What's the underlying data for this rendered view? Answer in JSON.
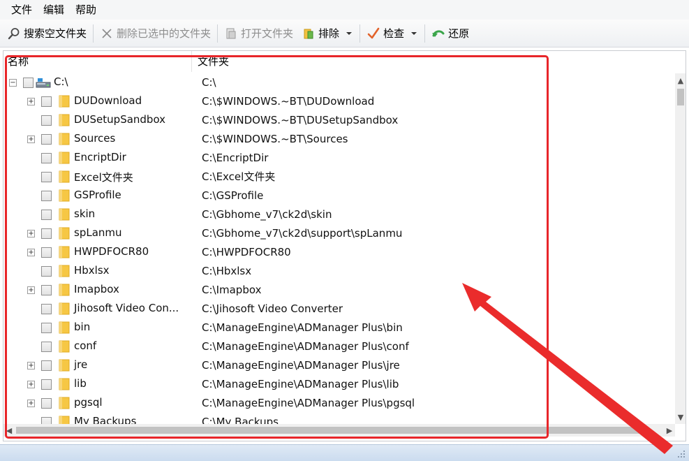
{
  "menu": [
    "文件",
    "编辑",
    "帮助"
  ],
  "toolbar": {
    "search_label": "搜索空文件夹",
    "delete_label": "删除已选中的文件夹",
    "open_label": "打开文件夹",
    "exclude_label": "排除",
    "check_label": "检查",
    "restore_label": "还原"
  },
  "columns": {
    "name": "名称",
    "folder": "文件夹"
  },
  "rows": [
    {
      "level": 0,
      "expander": "minus",
      "icon": "drive-icon",
      "name": "C:\\",
      "folder": "C:\\"
    },
    {
      "level": 1,
      "expander": "plus",
      "icon": "folder-icon",
      "name": "DUDownload",
      "folder": "C:\\$WINDOWS.~BT\\DUDownload"
    },
    {
      "level": 1,
      "expander": "",
      "icon": "folder-icon",
      "name": "DUSetupSandbox",
      "folder": "C:\\$WINDOWS.~BT\\DUSetupSandbox"
    },
    {
      "level": 1,
      "expander": "plus",
      "icon": "folder-icon",
      "name": "Sources",
      "folder": "C:\\$WINDOWS.~BT\\Sources"
    },
    {
      "level": 1,
      "expander": "",
      "icon": "folder-icon",
      "name": "EncriptDir",
      "folder": "C:\\EncriptDir"
    },
    {
      "level": 1,
      "expander": "",
      "icon": "folder-icon",
      "name": "Excel文件夹",
      "folder": "C:\\Excel文件夹"
    },
    {
      "level": 1,
      "expander": "",
      "icon": "folder-icon",
      "name": "GSProfile",
      "folder": "C:\\GSProfile"
    },
    {
      "level": 1,
      "expander": "",
      "icon": "folder-icon",
      "name": "skin",
      "folder": "C:\\Gbhome_v7\\ck2d\\skin"
    },
    {
      "level": 1,
      "expander": "plus",
      "icon": "folder-icon",
      "name": "spLanmu",
      "folder": "C:\\Gbhome_v7\\ck2d\\support\\spLanmu"
    },
    {
      "level": 1,
      "expander": "plus",
      "icon": "folder-icon",
      "name": "HWPDFOCR80",
      "folder": "C:\\HWPDFOCR80"
    },
    {
      "level": 1,
      "expander": "",
      "icon": "folder-icon",
      "name": "Hbxlsx",
      "folder": "C:\\Hbxlsx"
    },
    {
      "level": 1,
      "expander": "plus",
      "icon": "folder-icon",
      "name": "Imapbox",
      "folder": "C:\\Imapbox"
    },
    {
      "level": 1,
      "expander": "",
      "icon": "folder-icon",
      "name": "Jihosoft Video Con...",
      "folder": "C:\\Jihosoft Video Converter"
    },
    {
      "level": 1,
      "expander": "",
      "icon": "folder-icon",
      "name": "bin",
      "folder": "C:\\ManageEngine\\ADManager Plus\\bin"
    },
    {
      "level": 1,
      "expander": "",
      "icon": "folder-icon",
      "name": "conf",
      "folder": "C:\\ManageEngine\\ADManager Plus\\conf"
    },
    {
      "level": 1,
      "expander": "plus",
      "icon": "folder-icon",
      "name": "jre",
      "folder": "C:\\ManageEngine\\ADManager Plus\\jre"
    },
    {
      "level": 1,
      "expander": "plus",
      "icon": "folder-icon",
      "name": "lib",
      "folder": "C:\\ManageEngine\\ADManager Plus\\lib"
    },
    {
      "level": 1,
      "expander": "plus",
      "icon": "folder-icon",
      "name": "pgsql",
      "folder": "C:\\ManageEngine\\ADManager Plus\\pgsql"
    },
    {
      "level": 1,
      "expander": "",
      "icon": "folder-icon",
      "name": "My Backups",
      "folder": "C:\\My Backups"
    }
  ],
  "colors": {
    "highlight": "#e8262a",
    "folder": "#f6c744",
    "statusbar": "#cbdcef"
  }
}
